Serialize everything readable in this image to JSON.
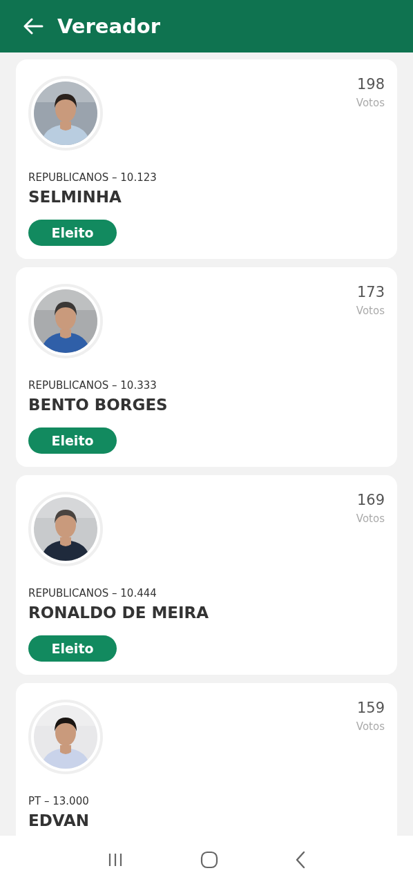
{
  "header": {
    "title": "Vereador"
  },
  "candidates": [
    {
      "votes": "198",
      "votes_label": "Votos",
      "party": "REPUBLICANOS – 10.123",
      "name": "SELMINHA",
      "badge": "Eleito"
    },
    {
      "votes": "173",
      "votes_label": "Votos",
      "party": "REPUBLICANOS – 10.333",
      "name": "BENTO BORGES",
      "badge": "Eleito"
    },
    {
      "votes": "169",
      "votes_label": "Votos",
      "party": "REPUBLICANOS – 10.444",
      "name": "RONALDO DE MEIRA",
      "badge": "Eleito"
    },
    {
      "votes": "159",
      "votes_label": "Votos",
      "party": "PT – 13.000",
      "name": "EDVAN"
    }
  ]
}
